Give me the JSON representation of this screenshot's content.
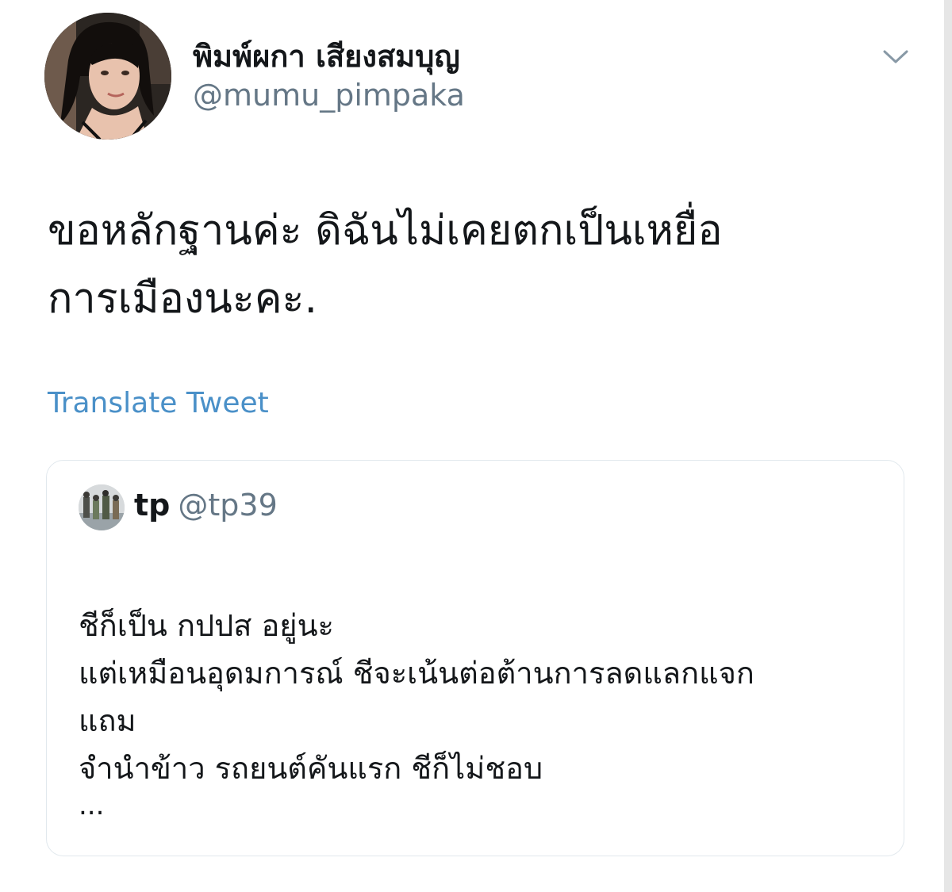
{
  "tweet": {
    "author": {
      "display_name": "พิมพ์ผกา เสียงสมบุญ",
      "handle": "@mumu_pimpaka",
      "avatar_icon": "profile-photo"
    },
    "menu_icon": "chevron-down-icon",
    "text_lines": [
      "ขอหลักฐานค่ะ  ดิฉันไม่เคยตกเป็นเหยื่อ",
      "การเมืองนะคะ."
    ],
    "translate_label": "Translate Tweet",
    "colors": {
      "link": "#4a90c8",
      "secondary_text": "#657786",
      "primary_text": "#14171a",
      "border": "#e1e8ed"
    }
  },
  "quoted_tweet": {
    "author": {
      "name": "tp",
      "handle": "@tp39"
    },
    "lines": [
      "ชีก็เป็น กปปส อยู่นะ",
      "แต่เหมือนอุดมการณ์ ชีจะเน้นต่อต้านการลดแลกแจก",
      "แถม",
      "จำนำข้าว รถยนต์คันแรก ชีก็ไม่ชอบ"
    ],
    "ellipsis": "..."
  }
}
